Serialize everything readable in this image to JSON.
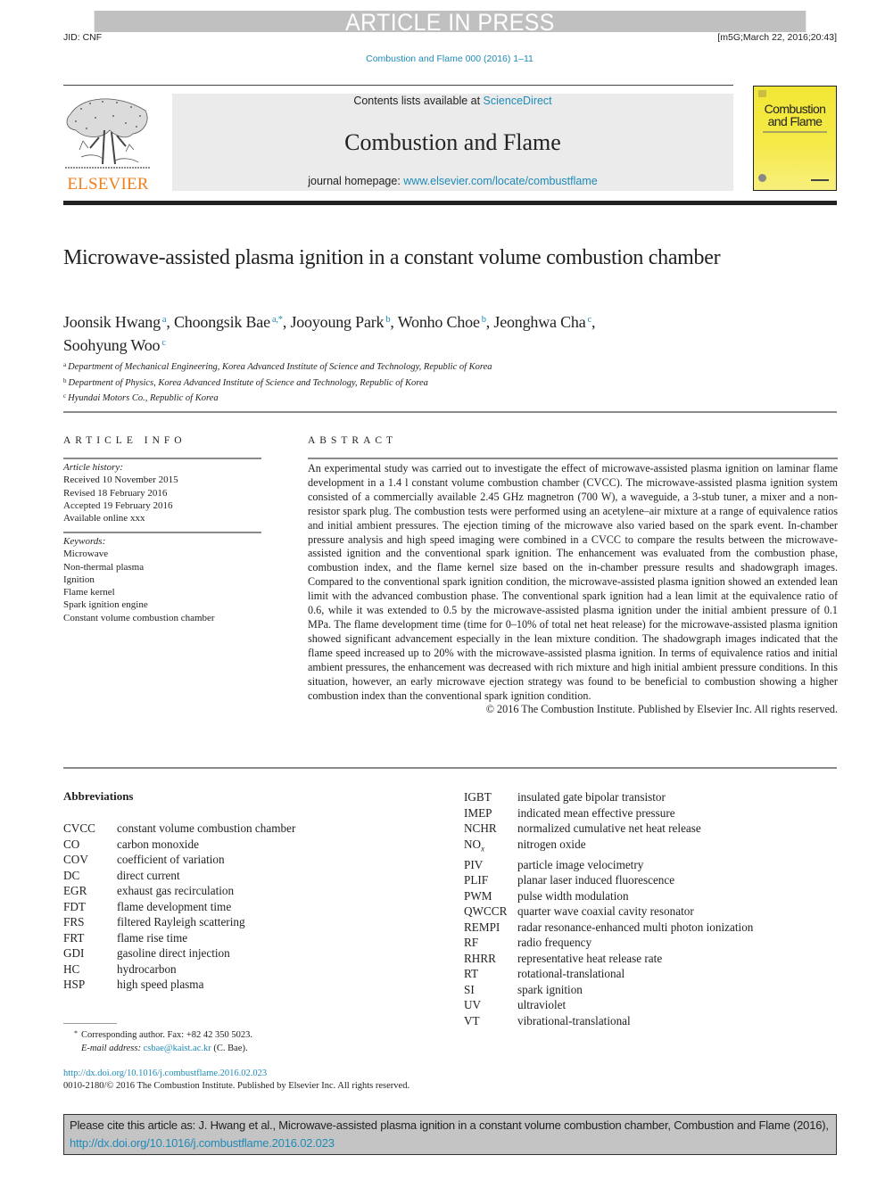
{
  "banner": {
    "article_in_press": "ARTICLE IN PRESS",
    "jid": "JID: CNF",
    "stamp": "[m5G;March 22, 2016;20:43]",
    "journal_ref": "Combustion and Flame 000 (2016) 1–11"
  },
  "masthead": {
    "publisher_logo_text": "ELSEVIER",
    "contents_prefix": "Contents lists available at ",
    "contents_link": "ScienceDirect",
    "journal_title": "Combustion and Flame",
    "homepage_prefix": "journal homepage: ",
    "homepage_link": "www.elsevier.com/locate/combustflame",
    "cover_title": "Combustion and Flame"
  },
  "article": {
    "title": "Microwave-assisted plasma ignition in a constant volume combustion chamber",
    "authors": [
      {
        "name": "Joonsik Hwang",
        "aff": "a"
      },
      {
        "name": "Choongsik Bae",
        "aff": "a,*"
      },
      {
        "name": "Jooyoung Park",
        "aff": "b"
      },
      {
        "name": "Wonho Choe",
        "aff": "b"
      },
      {
        "name": "Jeonghwa Cha",
        "aff": "c"
      },
      {
        "name": "Soohyung Woo",
        "aff": "c"
      }
    ],
    "affiliations": [
      {
        "mark": "a",
        "text": "Department of Mechanical Engineering, Korea Advanced Institute of Science and Technology, Republic of Korea"
      },
      {
        "mark": "b",
        "text": "Department of Physics, Korea Advanced Institute of Science and Technology, Republic of Korea"
      },
      {
        "mark": "c",
        "text": "Hyundai Motors Co., Republic of Korea"
      }
    ]
  },
  "article_info": {
    "heading": "ARTICLE INFO",
    "history_label": "Article history:",
    "history": [
      "Received 10 November 2015",
      "Revised 18 February 2016",
      "Accepted 19 February 2016",
      "Available online xxx"
    ],
    "keywords_label": "Keywords:",
    "keywords": [
      "Microwave",
      "Non-thermal plasma",
      "Ignition",
      "Flame kernel",
      "Spark ignition engine",
      "Constant volume combustion chamber"
    ]
  },
  "abstract": {
    "heading": "ABSTRACT",
    "text": "An experimental study was carried out to investigate the effect of microwave-assisted plasma ignition on laminar flame development in a 1.4 l constant volume combustion chamber (CVCC). The microwave-assisted plasma ignition system consisted of a commercially available 2.45 GHz magnetron (700 W), a waveguide, a 3-stub tuner, a mixer and a non-resistor spark plug. The combustion tests were performed using an acetylene–air mixture at a range of equivalence ratios and initial ambient pressures. The ejection timing of the microwave also varied based on the spark event. In-chamber pressure analysis and high speed imaging were combined in a CVCC to compare the results between the microwave-assisted ignition and the conventional spark ignition. The enhancement was evaluated from the combustion phase, combustion index, and the flame kernel size based on the in-chamber pressure results and shadowgraph images. Compared to the conventional spark ignition condition, the microwave-assisted plasma ignition showed an extended lean limit with the advanced combustion phase. The conventional spark ignition had a lean limit at the equivalence ratio of 0.6, while it was extended to 0.5 by the microwave-assisted plasma ignition under the initial ambient pressure of 0.1 MPa. The flame development time (time for 0–10% of total net heat release) for the microwave-assisted plasma ignition showed significant advancement especially in the lean mixture condition. The shadowgraph images indicated that the flame speed increased up to 20% with the microwave-assisted plasma ignition. In terms of equivalence ratios and initial ambient pressures, the enhancement was decreased with rich mixture and high initial ambient pressure conditions. In this situation, however, an early microwave ejection strategy was found to be beneficial to combustion showing a higher combustion index than the conventional spark ignition condition.",
    "copyright": "© 2016 The Combustion Institute. Published by Elsevier Inc. All rights reserved."
  },
  "abbreviations": {
    "heading": "Abbreviations",
    "left": [
      {
        "k": "CVCC",
        "v": "constant volume combustion chamber"
      },
      {
        "k": "CO",
        "v": "carbon monoxide"
      },
      {
        "k": "COV",
        "v": "coefficient of variation"
      },
      {
        "k": "DC",
        "v": "direct current"
      },
      {
        "k": "EGR",
        "v": "exhaust gas recirculation"
      },
      {
        "k": "FDT",
        "v": "flame development time"
      },
      {
        "k": "FRS",
        "v": "filtered Rayleigh scattering"
      },
      {
        "k": "FRT",
        "v": "flame rise time"
      },
      {
        "k": "GDI",
        "v": "gasoline direct injection"
      },
      {
        "k": "HC",
        "v": "hydrocarbon"
      },
      {
        "k": "HSP",
        "v": "high speed plasma"
      }
    ],
    "right": [
      {
        "k": "IGBT",
        "v": "insulated gate bipolar transistor"
      },
      {
        "k": "IMEP",
        "v": "indicated mean effective pressure"
      },
      {
        "k": "NCHR",
        "v": "normalized cumulative net heat release"
      },
      {
        "k": "NO",
        "sub": "x",
        "v": "nitrogen oxide"
      },
      {
        "k": "PIV",
        "v": "particle image velocimetry"
      },
      {
        "k": "PLIF",
        "v": "planar laser induced fluorescence"
      },
      {
        "k": "PWM",
        "v": "pulse width modulation"
      },
      {
        "k": "QWCCR",
        "v": "quarter wave coaxial cavity resonator"
      },
      {
        "k": "REMPI",
        "v": "radar resonance-enhanced multi photon ionization"
      },
      {
        "k": "RF",
        "v": "radio frequency"
      },
      {
        "k": "RHRR",
        "v": "representative heat release rate"
      },
      {
        "k": "RT",
        "v": "rotational-translational"
      },
      {
        "k": "SI",
        "v": "spark ignition"
      },
      {
        "k": "UV",
        "v": "ultraviolet"
      },
      {
        "k": "VT",
        "v": "vibrational-translational"
      }
    ]
  },
  "footnotes": {
    "star": "*",
    "corresponding": "Corresponding author. Fax: +82 42 350 5023.",
    "email_label": "E-mail address:",
    "email": "csbae@kaist.ac.kr",
    "email_suffix": " (C. Bae).",
    "doi": "http://dx.doi.org/10.1016/j.combustflame.2016.02.023",
    "issn_line": "0010-2180/© 2016 The Combustion Institute. Published by Elsevier Inc. All rights reserved."
  },
  "cite": {
    "text": "Please cite this article as: J. Hwang et al., Microwave-assisted plasma ignition in a constant volume combustion chamber, Combustion and Flame (2016), ",
    "link": "http://dx.doi.org/10.1016/j.combustflame.2016.02.023"
  }
}
